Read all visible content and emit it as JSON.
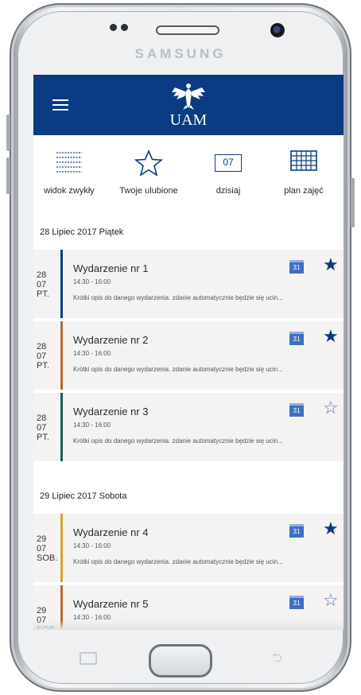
{
  "device": {
    "brand": "SAMSUNG"
  },
  "appbar": {
    "logo_text": "UAM",
    "color": "#0b3b82"
  },
  "toolbar": {
    "items": [
      {
        "label": "widok zwykły",
        "icon": "grid-dots-icon"
      },
      {
        "label": "Twoje ulubione",
        "icon": "star-outline-icon"
      },
      {
        "label": "dzisiaj",
        "icon": "calendar-day-icon",
        "day": "07"
      },
      {
        "label": "plan zajęć",
        "icon": "schedule-grid-icon"
      }
    ]
  },
  "sections": [
    {
      "title": "28 Lipiec 2017 Piątek",
      "events": [
        {
          "day": "28",
          "month": "07",
          "weekday": "PT.",
          "title": "Wydarzenie nr 1",
          "time": "14:30 - 16:00",
          "desc": "Krótki opis do danego wydarzenia. zdanie automatycznie będzie się ucin...",
          "cal": "31",
          "favorite": true,
          "bar_color": "#0b3b82"
        },
        {
          "day": "28",
          "month": "07",
          "weekday": "PT.",
          "title": "Wydarzenie nr 2",
          "time": "14:30 - 16:00",
          "desc": "Krótki opis do danego wydarzenia. zdanie automatycznie będzie się ucin...",
          "cal": "31",
          "favorite": true,
          "bar_color": "#b86a2e"
        },
        {
          "day": "28",
          "month": "07",
          "weekday": "PT.",
          "title": "Wydarzenie nr 3",
          "time": "14:30 - 16:00",
          "desc": "Krótki opis do danego wydarzenia. zdanie automatycznie będzie się ucin...",
          "cal": "31",
          "favorite": false,
          "bar_color": "#1f5c56"
        }
      ]
    },
    {
      "title": "29 Lipiec 2017 Sobota",
      "events": [
        {
          "day": "29",
          "month": "07",
          "weekday": "SOB.",
          "title": "Wydarzenie nr 4",
          "time": "14:30 - 16:00",
          "desc": "Krótki opis do danego wydarzenia. zdanie automatycznie będzie się ucin...",
          "cal": "31",
          "favorite": true,
          "bar_color": "#d7a12c"
        },
        {
          "day": "29",
          "month": "07",
          "weekday": "SOB.",
          "title": "Wydarzenie nr 5",
          "time": "14:30 - 16:00",
          "desc": "",
          "cal": "31",
          "favorite": false,
          "bar_color": "#b86a2e"
        }
      ]
    }
  ]
}
